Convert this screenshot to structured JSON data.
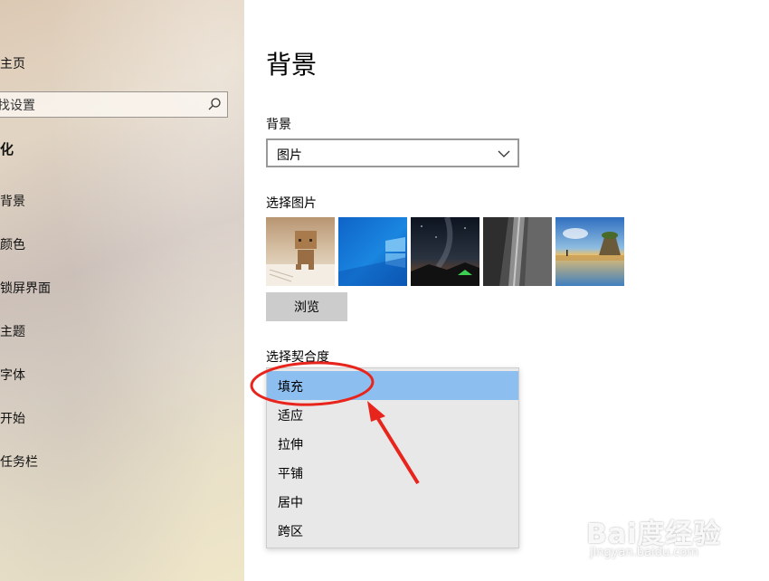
{
  "sidebar": {
    "home_label": "主页",
    "search_placeholder": "找设置",
    "section_title": "化",
    "items": [
      {
        "label": "背景"
      },
      {
        "label": "颜色"
      },
      {
        "label": "锁屏界面"
      },
      {
        "label": "主题"
      },
      {
        "label": "字体"
      },
      {
        "label": "开始"
      },
      {
        "label": "任务栏"
      }
    ]
  },
  "main": {
    "title": "背景",
    "background_label": "背景",
    "background_value": "图片",
    "choose_picture_label": "选择图片",
    "browse_label": "浏览",
    "fit_label": "选择契合度",
    "fit_options": [
      "填充",
      "适应",
      "拉伸",
      "平铺",
      "居中",
      "跨区"
    ],
    "fit_selected": "填充"
  },
  "watermark": {
    "logo": "Bai度经验",
    "url": "jingyan.baidu.com"
  },
  "colors": {
    "selected_option": "#8cbff0",
    "annotation_red": "#e8251c"
  }
}
